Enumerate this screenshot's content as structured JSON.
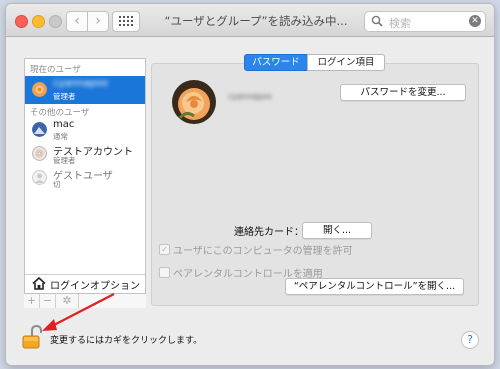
{
  "window": {
    "title": "“ユーザとグループ”を読み込み中...",
    "search_placeholder": "検索"
  },
  "sidebar": {
    "current_header": "現在のユーザ",
    "current_user": {
      "name": "cyannapoo",
      "role": "管理者"
    },
    "others_header": "その他のユーザ",
    "others": [
      {
        "name": "mac",
        "role": "通常",
        "icon": "mac-avatar-icon"
      },
      {
        "name": "テストアカウント",
        "role": "管理者",
        "icon": "cd-avatar-icon"
      },
      {
        "name": "ゲストユーザ",
        "role": "切",
        "icon": "guest-avatar-icon"
      }
    ],
    "login_options": "ログインオプション",
    "add_label": "+",
    "remove_label": "−",
    "gear_label": "✲"
  },
  "tabs": [
    "パスワード",
    "ログイン項目"
  ],
  "detail": {
    "user_name": "cyannapoo",
    "change_password_button": "パスワードを変更...",
    "contact_card_label": "連絡先カード：",
    "open_button": "開く...",
    "admin_checkbox": "ユーザにこのコンピュータの管理を許可",
    "parental_checkbox": "ペアレンタルコントロールを適用",
    "open_parental_button": "“ペアレンタルコントロール”を開く..."
  },
  "footer": {
    "lock_text": "変更するにはカギをクリックします。",
    "help": "?"
  },
  "colors": {
    "accent": "#1a76d9",
    "annotation_arrow": "#e02020"
  }
}
